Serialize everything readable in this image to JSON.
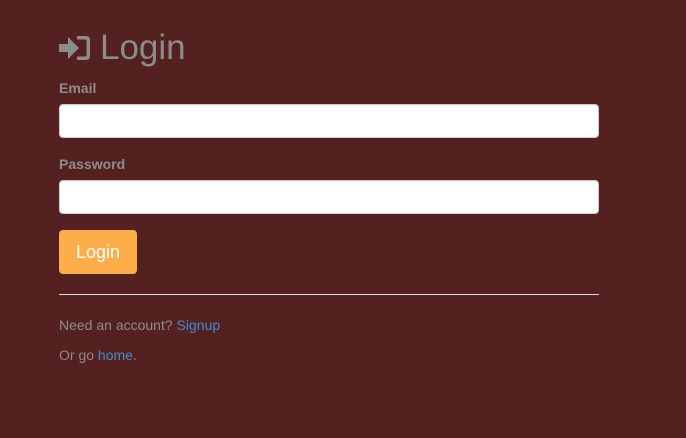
{
  "page": {
    "icon": "sign-in-icon",
    "title": "Login"
  },
  "form": {
    "email_label": "Email",
    "email_value": "",
    "password_label": "Password",
    "password_value": "",
    "submit_label": "Login"
  },
  "footer": {
    "signup_prompt": "Need an account? ",
    "signup_link": "Signup",
    "home_prefix": "Or go ",
    "home_link": "home",
    "home_suffix": "."
  },
  "colors": {
    "background": "#552020",
    "text_muted": "#8c8c8c",
    "button_bg": "#fdad4a",
    "link": "#428bca"
  }
}
